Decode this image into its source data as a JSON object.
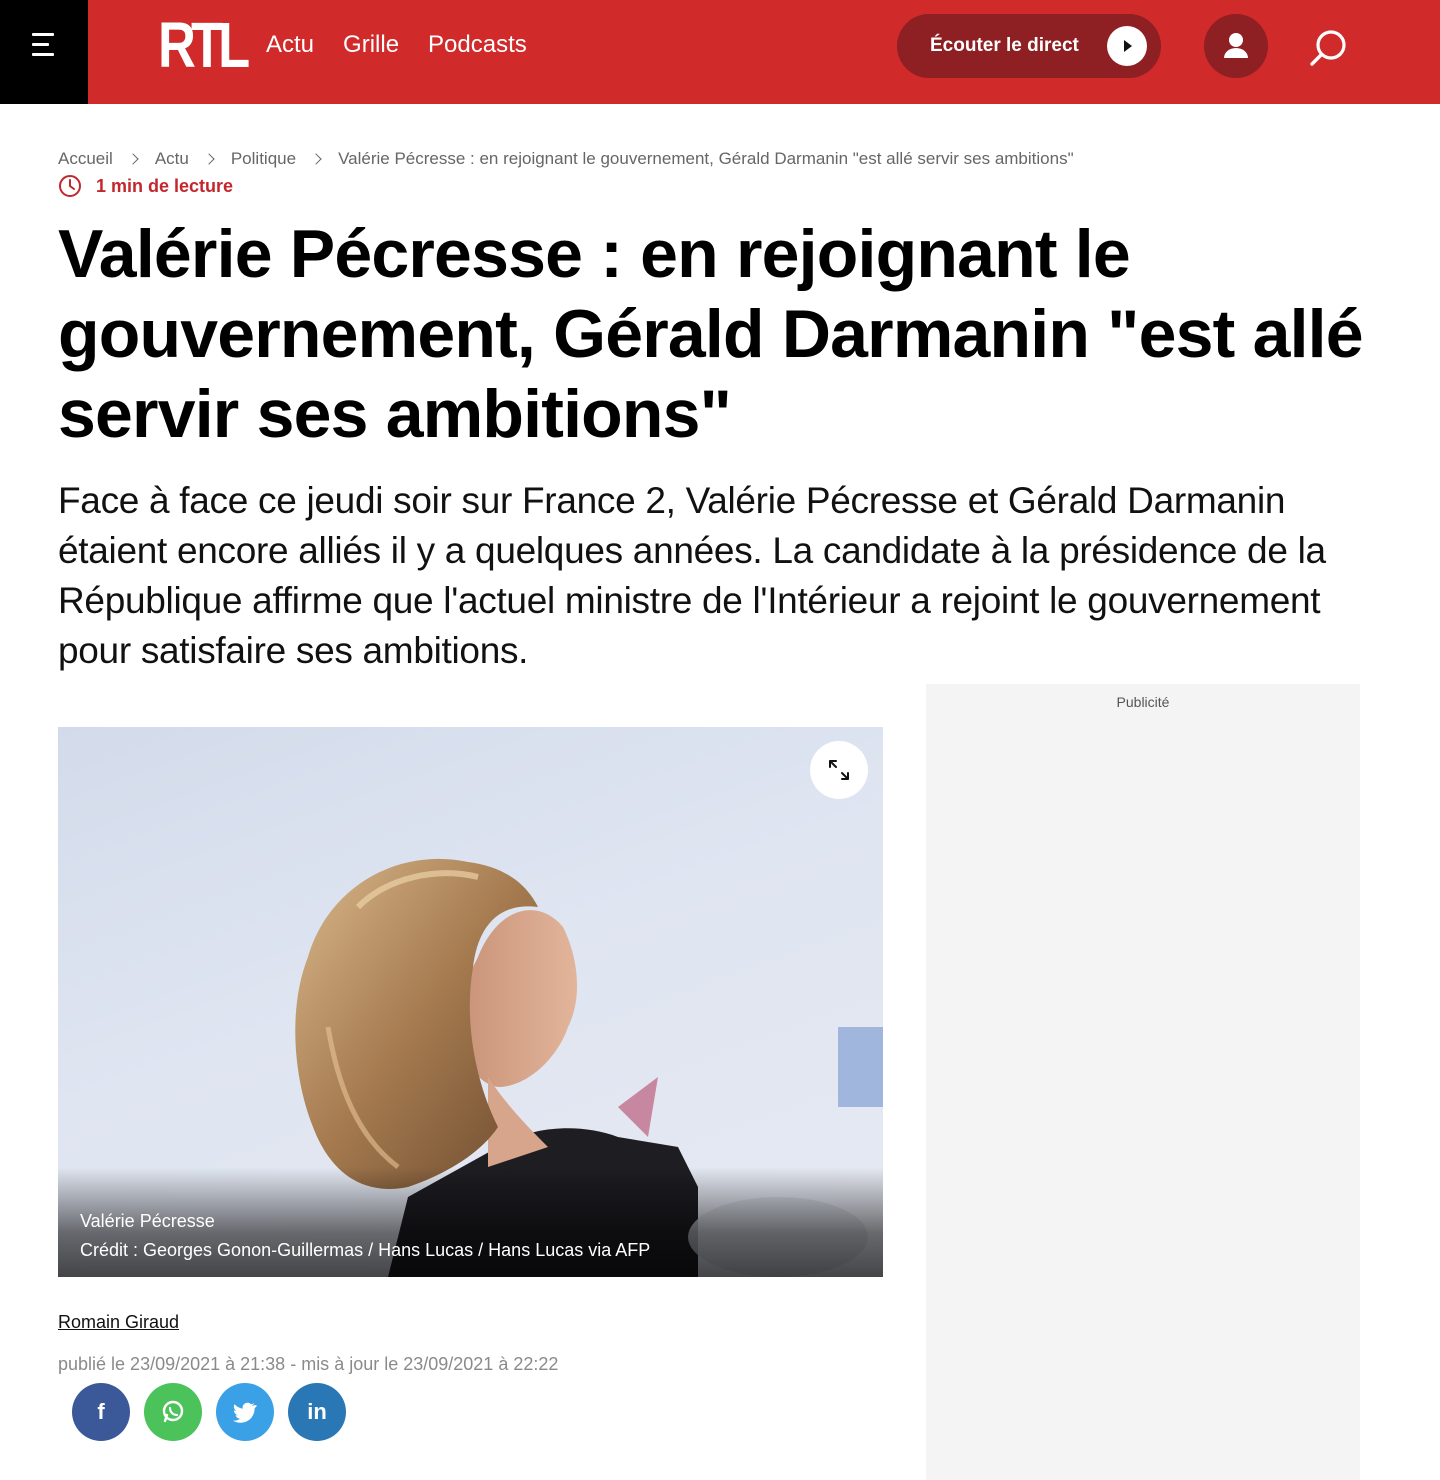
{
  "header": {
    "logo": "RTL",
    "nav": [
      "Actu",
      "Grille",
      "Podcasts"
    ],
    "listen_label": "Écouter le direct",
    "brand_color": "#d12a2a",
    "dark_red": "#8e1f22",
    "icons": [
      "menu-icon",
      "play-icon",
      "user-icon",
      "search-icon"
    ]
  },
  "breadcrumb": [
    "Accueil",
    "Actu",
    "Politique",
    "Valérie Pécresse : en rejoignant le gouvernement, Gérald Darmanin \"est allé servir ses ambitions\""
  ],
  "read_time": "1 min de lecture",
  "article": {
    "title": "Valérie Pécresse : en rejoignant le gouvernement, Gérald Darmanin \"est allé servir ses ambitions\"",
    "lead": "Face à face ce jeudi soir sur France 2, Valérie Pécresse et Gérald Darmanin étaient encore alliés il y a quelques années. La candidate à la présidence de la République affirme que l'actuel ministre de l'Intérieur a rejoint le gouvernement pour satisfaire ses ambitions.",
    "image_caption": "Valérie Pécresse",
    "image_credit": "Crédit : Georges Gonon-Guillermas / Hans Lucas / Hans Lucas via AFP",
    "author": "Romain Giraud",
    "dates": "publié le 23/09/2021 à 21:38 - mis à jour le 23/09/2021 à 22:22"
  },
  "ad_label": "Publicité",
  "share": [
    {
      "name": "facebook",
      "glyph": "f",
      "color": "#3b5998"
    },
    {
      "name": "whatsapp",
      "glyph": "",
      "color": "#4cc35a"
    },
    {
      "name": "twitter",
      "glyph": "",
      "color": "#3aa1e6"
    },
    {
      "name": "linkedin",
      "glyph": "in",
      "color": "#2a77b5"
    }
  ]
}
